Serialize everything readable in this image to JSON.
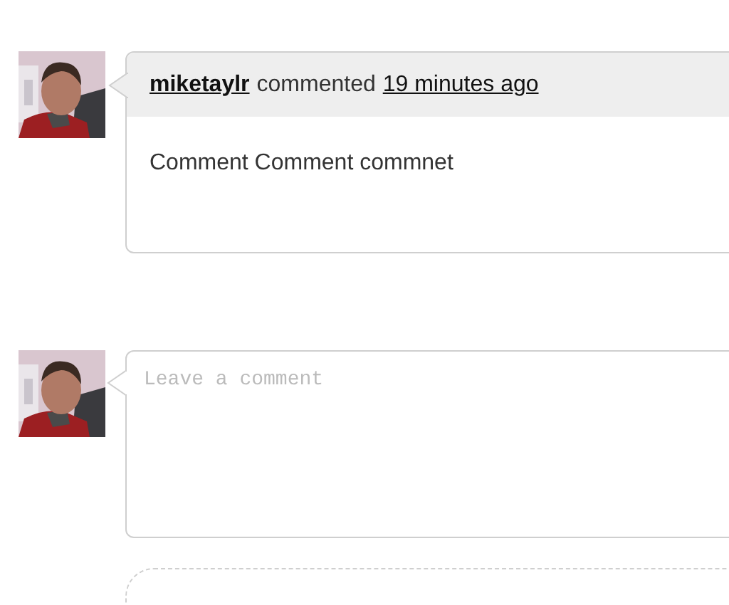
{
  "comment": {
    "author": "miketaylr",
    "action": "commented",
    "time": "19 minutes ago",
    "body": "Comment Comment commnet"
  },
  "composer": {
    "placeholder": "Leave a comment"
  }
}
